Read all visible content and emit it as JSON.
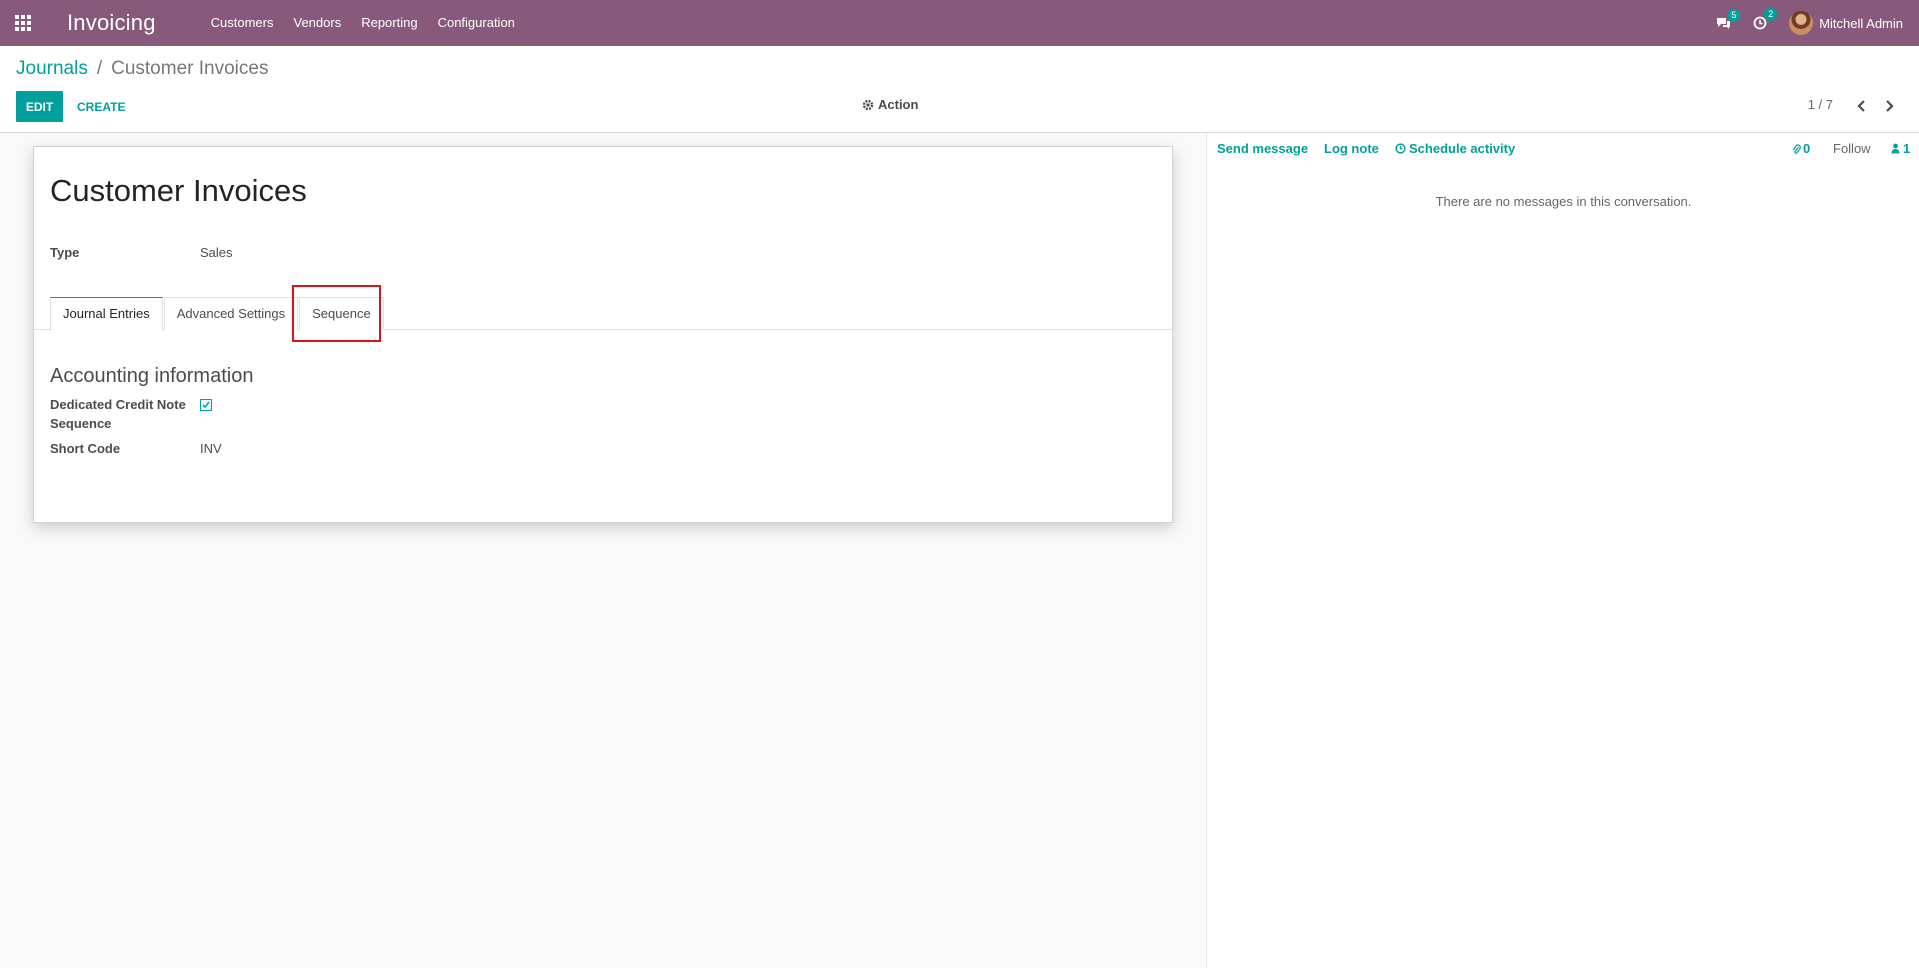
{
  "navbar": {
    "app_name": "Invoicing",
    "menu": [
      "Customers",
      "Vendors",
      "Reporting",
      "Configuration"
    ],
    "messages_count": "5",
    "activities_count": "2",
    "user_name": "Mitchell Admin",
    "color": "#875a7b"
  },
  "breadcrumb": {
    "parent": "Journals",
    "separator": "/",
    "current": "Customer Invoices"
  },
  "control_panel": {
    "edit_label": "EDIT",
    "create_label": "CREATE",
    "action_label": "Action",
    "pager_text": "1 / 7"
  },
  "form": {
    "title": "Customer Invoices",
    "type_label": "Type",
    "type_value": "Sales",
    "tabs": [
      "Journal Entries",
      "Advanced Settings",
      "Sequence"
    ],
    "active_tab": "Journal Entries",
    "highlighted_tab": "Sequence",
    "section_title": "Accounting information",
    "credit_note_label_line1": "Dedicated Credit Note",
    "credit_note_label_line2": "Sequence",
    "credit_note_checked": true,
    "short_code_label": "Short Code",
    "short_code_value": "INV"
  },
  "chatter": {
    "send_message": "Send message",
    "log_note": "Log note",
    "schedule_activity": "Schedule activity",
    "attachments_count": "0",
    "follow_label": "Follow",
    "followers_count": "1",
    "empty_text": "There are no messages in this conversation."
  },
  "colors": {
    "accent": "#00a09d",
    "brand": "#875a7b",
    "highlight": "#e0101e"
  }
}
